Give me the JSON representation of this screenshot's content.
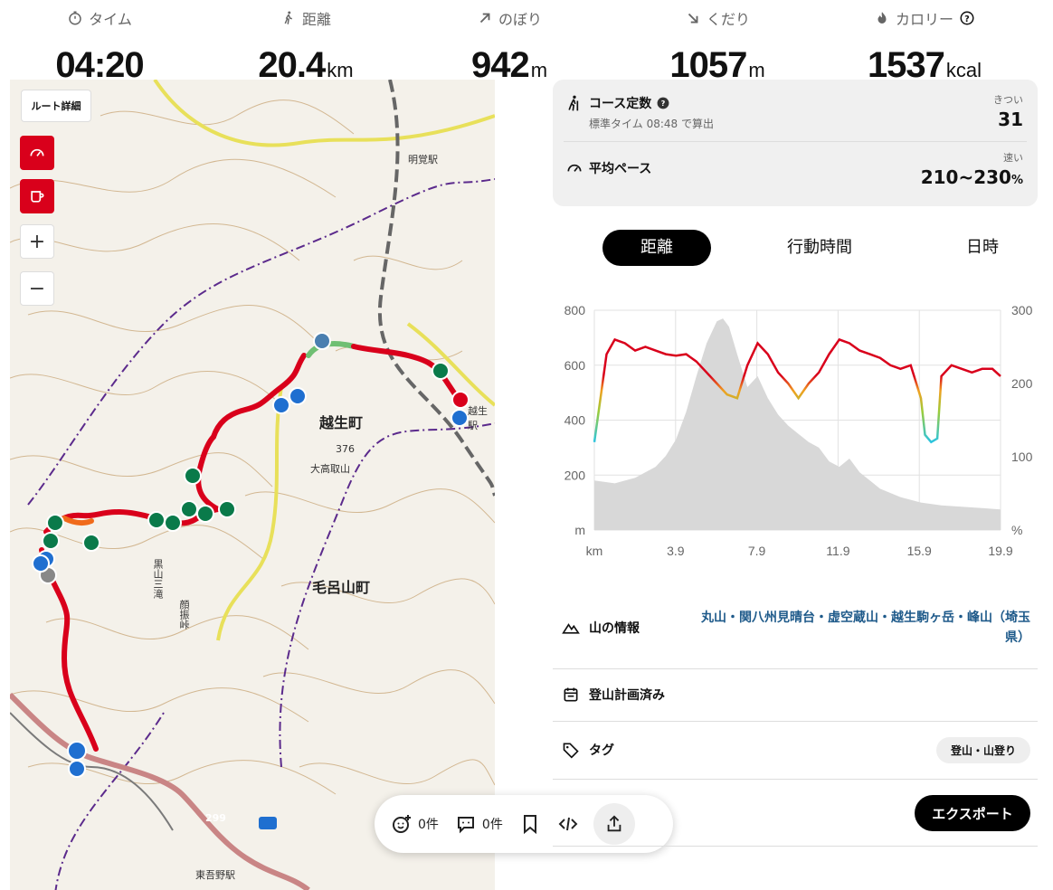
{
  "stats": [
    {
      "label": "タイム",
      "value": "04:20",
      "unit": "",
      "icon": "stopwatch-icon"
    },
    {
      "label": "距離",
      "value": "20.4",
      "unit": "km",
      "icon": "walking-icon"
    },
    {
      "label": "のぼり",
      "value": "942",
      "unit": "m",
      "icon": "arrow-up-right-icon"
    },
    {
      "label": "くだり",
      "value": "1057",
      "unit": "m",
      "icon": "arrow-down-right-icon"
    },
    {
      "label": "カロリー",
      "value": "1537",
      "unit": "kcal",
      "icon": "flame-icon"
    }
  ],
  "map": {
    "route_detail": "ルート詳細",
    "zoom_in": "+",
    "zoom_out": "−",
    "labels": {
      "town1": "越生町",
      "town2": "毛呂山町",
      "peak": "大高取山",
      "elev": "376",
      "station1": "明覚駅",
      "station2": "越生駅",
      "station3": "東吾野駅",
      "road": "299",
      "waterfall": "黒山三滝",
      "pass": "顔振峠"
    },
    "colors": {
      "route": "#d9001b",
      "contour": "#c9a77a",
      "road": "#e8e05a"
    }
  },
  "bottom_bar": {
    "likes": "0件",
    "comments": "0件"
  },
  "course": {
    "title": "コース定数",
    "sub": "標準タイム 08:48 で算出",
    "hint": "きつい",
    "value": "31",
    "pace_title": "平均ペース",
    "pace_hint": "速い",
    "pace_value": "210~230",
    "pace_unit": "%"
  },
  "tabs": [
    "距離",
    "行動時間",
    "日時"
  ],
  "chart_data": {
    "type": "line",
    "x_ticks": [
      "km",
      "3.9",
      "7.9",
      "11.9",
      "15.9",
      "19.9"
    ],
    "y_left_ticks": [
      "800",
      "600",
      "400",
      "200",
      "m"
    ],
    "y_right_ticks": [
      "300",
      "200",
      "100",
      "%"
    ],
    "y_left_range": [
      0,
      800
    ],
    "y_right_range": [
      0,
      300
    ],
    "x_range": [
      0,
      19.9
    ],
    "elevation": {
      "x": [
        0,
        1,
        2,
        3,
        3.5,
        4,
        4.5,
        5,
        5.5,
        6,
        6.3,
        6.6,
        7,
        7.5,
        8,
        8.5,
        9,
        9.5,
        10,
        10.5,
        11,
        11.5,
        12,
        12.5,
        13,
        13.5,
        14,
        15,
        16,
        17,
        18,
        19,
        19.9
      ],
      "y": [
        180,
        170,
        190,
        230,
        270,
        330,
        430,
        560,
        680,
        760,
        770,
        740,
        640,
        520,
        560,
        480,
        420,
        380,
        350,
        320,
        300,
        250,
        230,
        260,
        210,
        180,
        150,
        120,
        100,
        90,
        85,
        80,
        75
      ]
    },
    "pace": {
      "x": [
        0,
        0.3,
        0.6,
        1,
        1.5,
        2,
        2.5,
        3,
        3.5,
        4,
        4.5,
        5,
        5.5,
        6,
        6.5,
        7,
        7.5,
        8,
        8.5,
        9,
        9.5,
        10,
        10.5,
        11,
        11.5,
        12,
        12.5,
        13,
        13.5,
        14,
        14.5,
        15,
        15.5,
        16,
        16.2,
        16.5,
        16.8,
        17,
        17.5,
        18,
        18.5,
        19,
        19.5,
        19.9
      ],
      "y": [
        120,
        180,
        240,
        260,
        255,
        245,
        250,
        245,
        240,
        238,
        240,
        230,
        215,
        200,
        185,
        180,
        225,
        255,
        240,
        215,
        200,
        180,
        200,
        215,
        240,
        260,
        255,
        245,
        240,
        235,
        225,
        220,
        225,
        180,
        130,
        120,
        125,
        210,
        225,
        220,
        215,
        220,
        220,
        210
      ]
    }
  },
  "info": {
    "mountain_label": "山の情報",
    "mountains": "丸山・関八州見晴台・虚空蔵山・越生駒ヶ岳・峰山（埼玉県）",
    "planned": "登山計画済み",
    "tag_label": "タグ",
    "tag_value": "登山・山登り",
    "export": "エクスポート"
  }
}
